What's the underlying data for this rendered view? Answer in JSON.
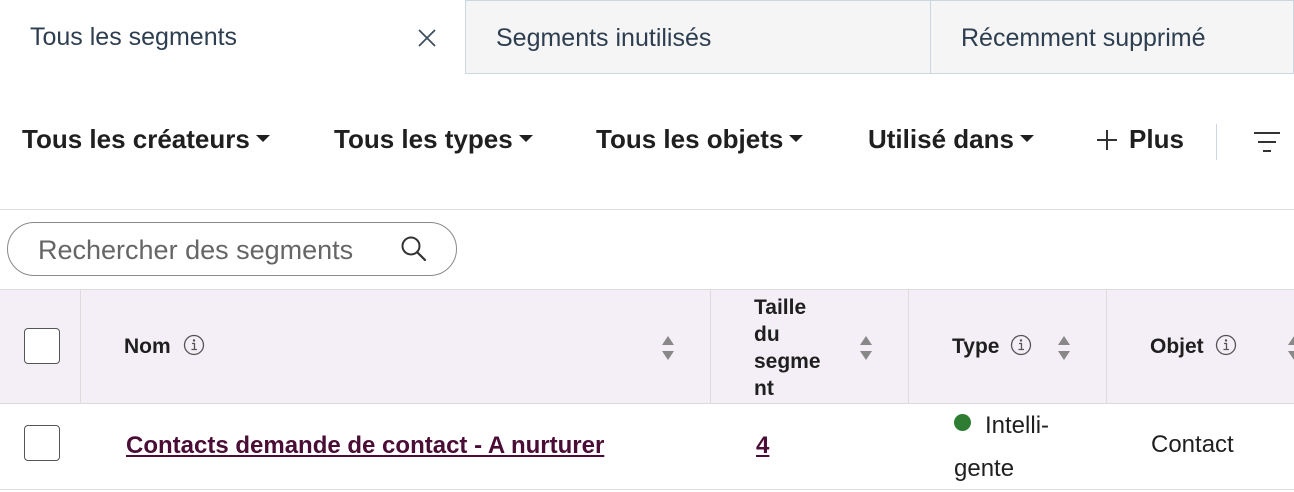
{
  "tabs": [
    {
      "label": "Tous les segments",
      "active": true
    },
    {
      "label": "Segments inutilisés",
      "active": false
    },
    {
      "label": "Récemment supprimé",
      "active": false
    }
  ],
  "filters": {
    "creators": "Tous les créateurs",
    "types": "Tous les types",
    "objects": "Tous les objets",
    "used_in": "Utilisé dans",
    "more": "Plus"
  },
  "search": {
    "placeholder": "Rechercher des segments",
    "value": ""
  },
  "table": {
    "headers": {
      "name": "Nom",
      "size": "Taille du segme nt",
      "type": "Type",
      "object": "Objet"
    },
    "rows": [
      {
        "name": "Contacts demande de contact - A nurturer",
        "size": "4",
        "type": "Intelli-gente",
        "type_color": "#2e7d32",
        "object": "Contact"
      }
    ]
  },
  "colors": {
    "link": "#4a0d35",
    "header_bg": "#f4eff6",
    "status_green": "#2e7d32"
  }
}
